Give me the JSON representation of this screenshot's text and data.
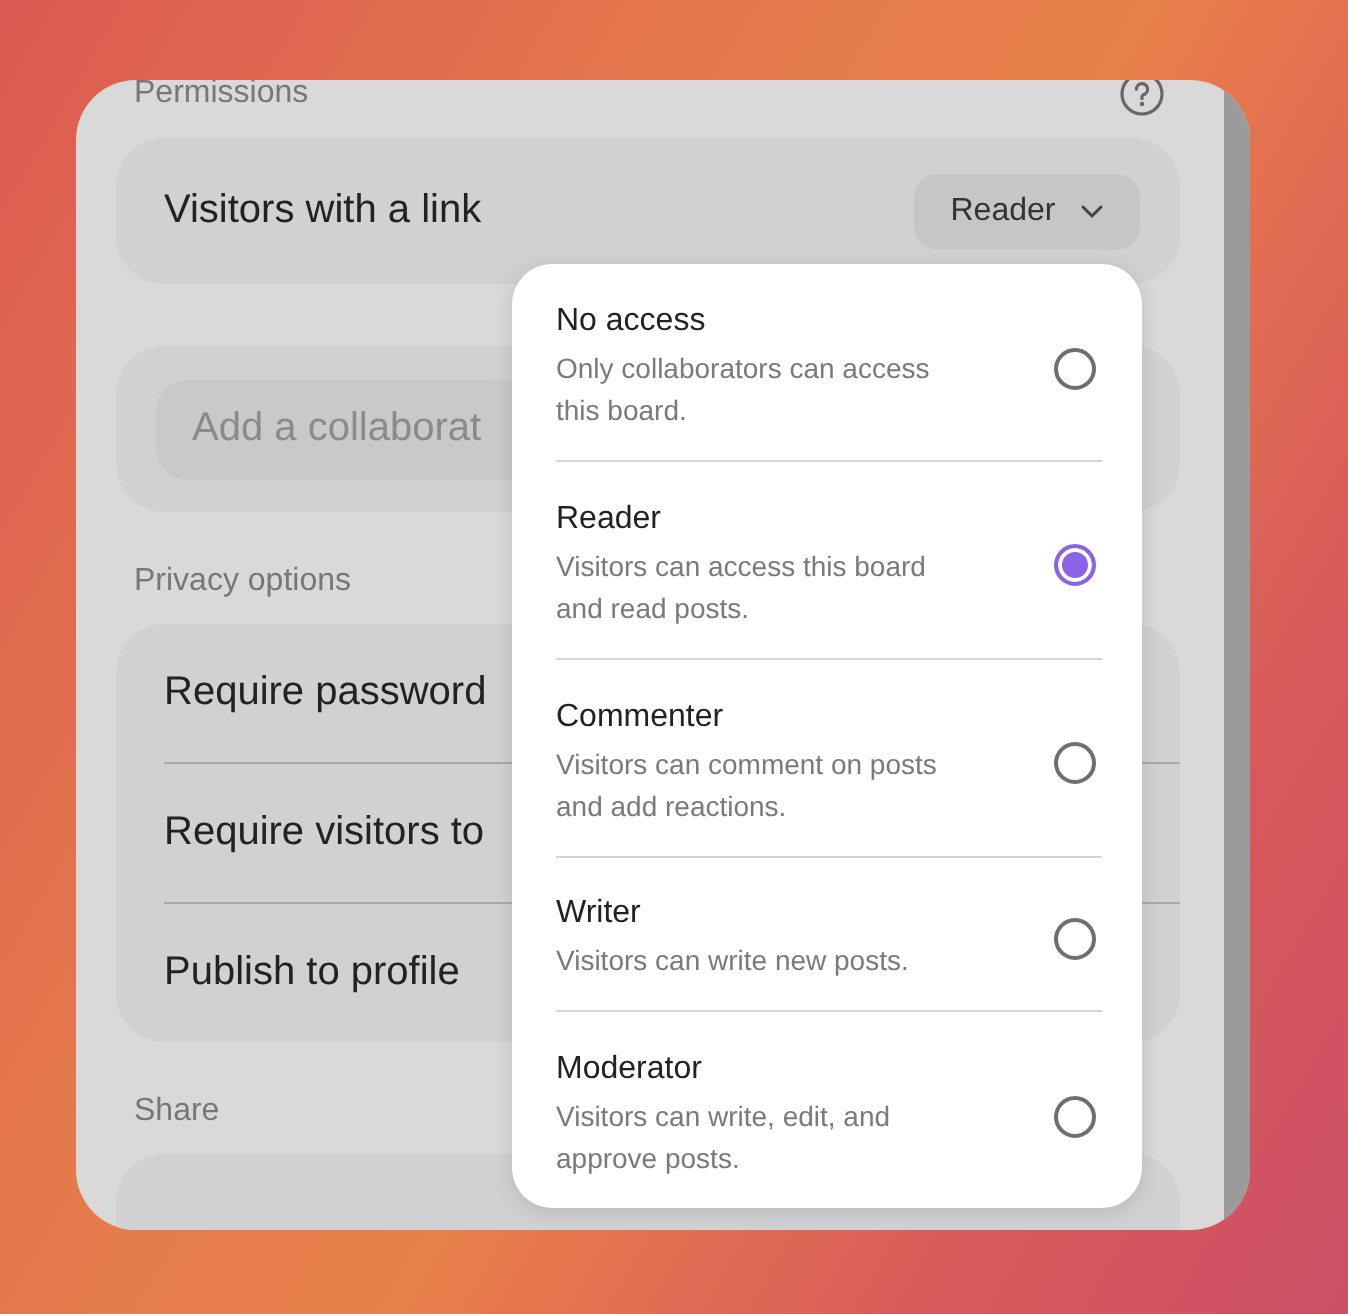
{
  "permissions": {
    "label": "Permissions",
    "link_access": {
      "label": "Visitors with a link",
      "value": "Reader"
    }
  },
  "collaborator_field": {
    "placeholder": "Add a collaborat"
  },
  "privacy": {
    "label": "Privacy options",
    "rows": [
      "Require password",
      "Require visitors to",
      "Publish to profile"
    ]
  },
  "share": {
    "label": "Share"
  },
  "access_menu": [
    {
      "title": "No access",
      "description": "Only collaborators can access this board.",
      "selected": false
    },
    {
      "title": "Reader",
      "description": "Visitors can access this board and read posts.",
      "selected": true
    },
    {
      "title": "Commenter",
      "description": "Visitors can comment on posts and add reactions.",
      "selected": false
    },
    {
      "title": "Writer",
      "description": "Visitors can write new posts.",
      "selected": false
    },
    {
      "title": "Moderator",
      "description": "Visitors can write, edit, and approve posts.",
      "selected": false
    }
  ]
}
